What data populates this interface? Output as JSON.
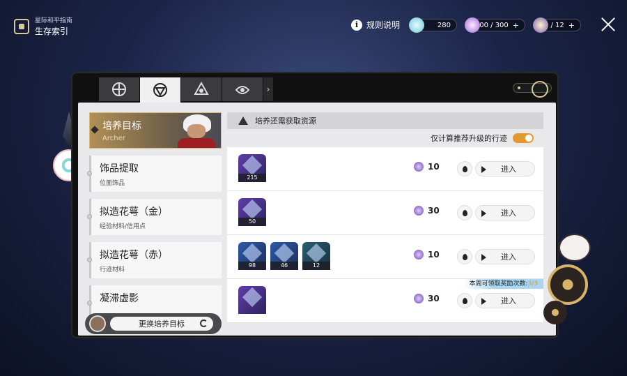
{
  "header": {
    "brand_sub": "星际和平指南",
    "brand_title": "生存索引",
    "rules_label": "规则说明",
    "currencies": [
      {
        "icon": "stellar-jade-icon",
        "value": "280",
        "has_plus": false
      },
      {
        "icon": "trailblaze-power-icon",
        "value": "300 / 300",
        "has_plus": true
      },
      {
        "icon": "fuel-icon",
        "value": "0 / 12",
        "has_plus": true
      }
    ]
  },
  "tabs": [
    {
      "icon": "tab-guide-icon",
      "active": false
    },
    {
      "icon": "tab-dimension-icon",
      "active": true
    },
    {
      "icon": "tab-trident-icon",
      "active": false
    },
    {
      "icon": "tab-lotus-icon",
      "active": false
    }
  ],
  "target": {
    "title": "培养目标",
    "character": "Archer"
  },
  "left_list": [
    {
      "title": "饰品提取",
      "sub": "位面饰品"
    },
    {
      "title": "拟造花萼（金）",
      "sub": "经验材料/信用点"
    },
    {
      "title": "拟造花萼（赤）",
      "sub": "行迹材料"
    },
    {
      "title": "凝滞虚影",
      "sub": ""
    }
  ],
  "change_target_label": "更换培养目标",
  "resources": {
    "header": "培养还需获取资源",
    "toggle_label": "仅计算推荐升级的行迹",
    "toggle_on": true,
    "rows": [
      {
        "items": [
          {
            "count": "215",
            "color": "purple"
          }
        ],
        "cost": "10",
        "go_label": "进入"
      },
      {
        "items": [
          {
            "count": "50",
            "color": "purple"
          }
        ],
        "cost": "30",
        "go_label": "进入"
      },
      {
        "items": [
          {
            "count": "98",
            "color": "blue"
          },
          {
            "count": "46",
            "color": "blue"
          },
          {
            "count": "12",
            "color": "teal"
          }
        ],
        "cost": "10",
        "go_label": "进入"
      },
      {
        "items": [
          {
            "count": "",
            "color": "purple"
          }
        ],
        "cost": "30",
        "go_label": "进入",
        "weekly_label": "本周可领取奖励次数:",
        "weekly_value": "3/3"
      }
    ]
  },
  "colors": {
    "accent_gold": "#d8b978",
    "toggle_orange": "#e29a2e",
    "weekly_blue": "#a9d6f1"
  }
}
